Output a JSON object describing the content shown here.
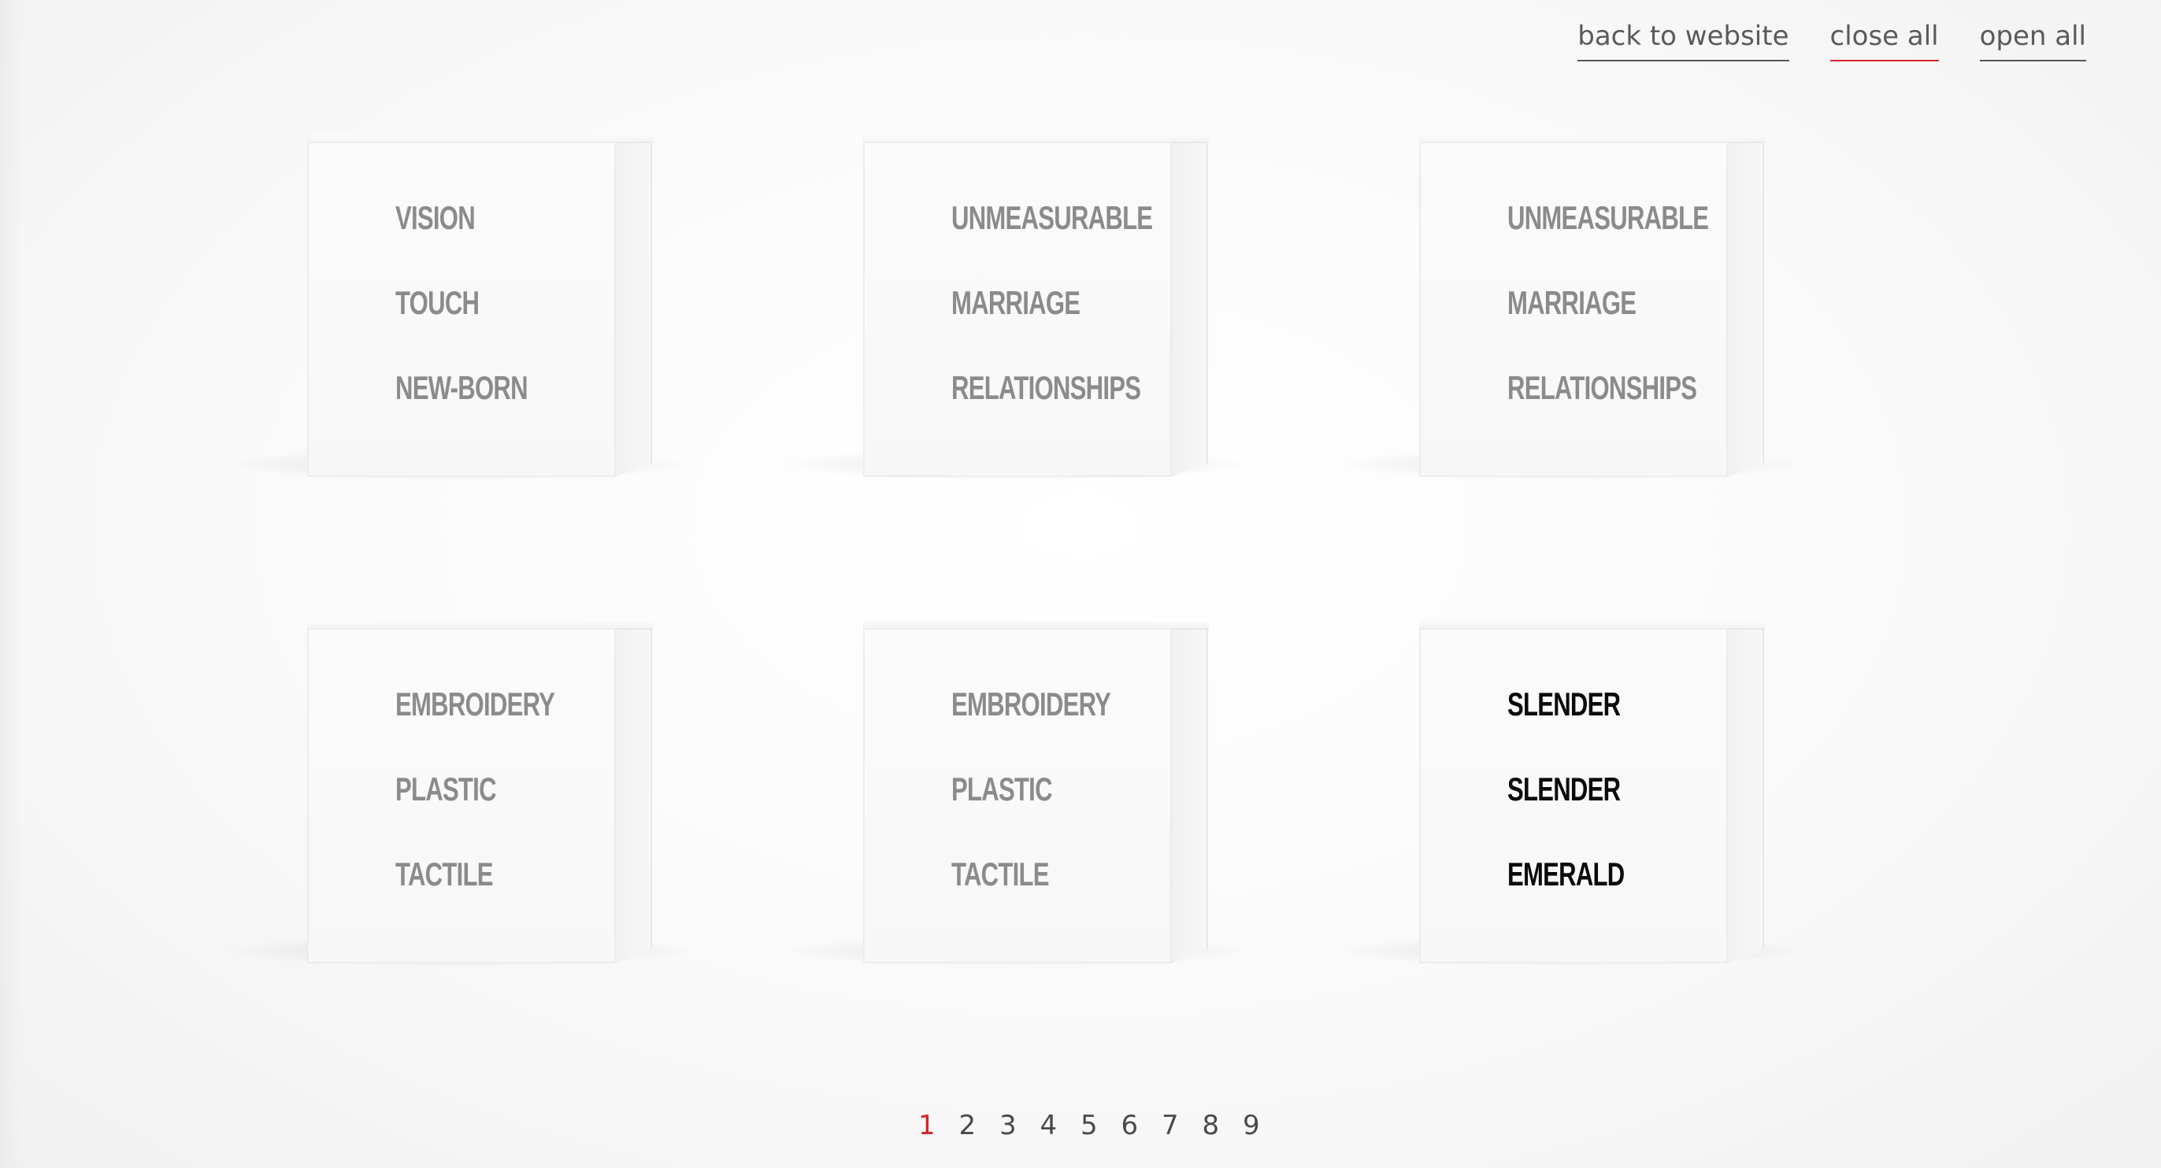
{
  "nav": {
    "links": [
      {
        "label": "back to website",
        "active": false
      },
      {
        "label": "close all",
        "active": true
      },
      {
        "label": "open all",
        "active": false
      }
    ]
  },
  "boxes": [
    {
      "words": [
        "VISION",
        "TOUCH",
        "NEW-BORN"
      ],
      "dark": false
    },
    {
      "words": [
        "UNMEASURABLE",
        "MARRIAGE",
        "RELATIONSHIPS"
      ],
      "dark": false
    },
    {
      "words": [
        "UNMEASURABLE",
        "MARRIAGE",
        "RELATIONSHIPS"
      ],
      "dark": false
    },
    {
      "words": [
        "EMBROIDERY",
        "PLASTIC",
        "TACTILE"
      ],
      "dark": false
    },
    {
      "words": [
        "EMBROIDERY",
        "PLASTIC",
        "TACTILE"
      ],
      "dark": false
    },
    {
      "words": [
        "SLENDER",
        "SLENDER",
        "EMERALD"
      ],
      "dark": true
    }
  ],
  "pagination": {
    "pages": [
      "1",
      "2",
      "3",
      "4",
      "5",
      "6",
      "7",
      "8",
      "9"
    ],
    "current": "1"
  },
  "colors": {
    "accent": "#d8232a",
    "word_light": "#8b8b8b",
    "word_dark": "#0b0b0b"
  }
}
